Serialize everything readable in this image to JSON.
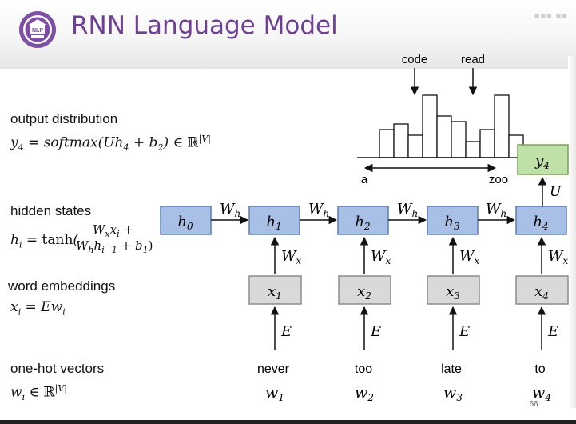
{
  "header": {
    "title": "RNN Language Model"
  },
  "labels": {
    "output": "output distribution",
    "hidden": "hidden states",
    "embeddings": "word embeddings",
    "onehot": "one-hot vectors"
  },
  "histogram": {
    "left_label": "a",
    "right_label": "zoo",
    "annotations": [
      "code",
      "read"
    ],
    "bar_heights": [
      0.35,
      0.42,
      0.28,
      0.78,
      0.52,
      0.45,
      0.2,
      0.35,
      0.78,
      0.28
    ]
  },
  "nodes": {
    "hidden": [
      "h0",
      "h1",
      "h2",
      "h3",
      "h4"
    ],
    "inputs": [
      "x1",
      "x2",
      "x3",
      "x4"
    ],
    "output": "y4"
  },
  "weights": {
    "recurrent": "W_h",
    "input": "W_x",
    "embed": "E",
    "out": "U"
  },
  "words": [
    "never",
    "too",
    "late",
    "to"
  ],
  "word_vars": [
    "w1",
    "w2",
    "w3",
    "w4"
  ],
  "page_number": "66",
  "colors": {
    "title": "#6e3f95",
    "hidden_fill": "#a9c0e6",
    "hidden_stroke": "#5b7db4",
    "input_fill": "#d9d9d9",
    "input_stroke": "#8c8c8c",
    "output_fill": "#bfe0a7",
    "output_stroke": "#7da05a"
  }
}
